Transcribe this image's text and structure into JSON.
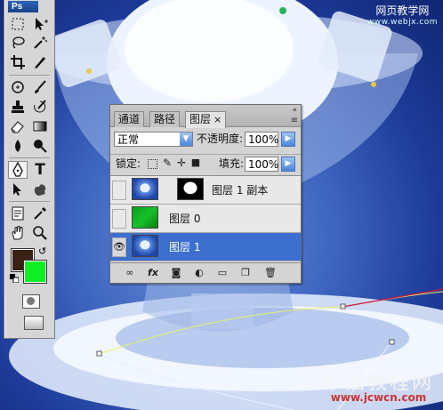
{
  "watermark_top": {
    "line1": "网页教学网",
    "line2": "www.webjx.com"
  },
  "watermark_bottom": {
    "line1": "中国教程网",
    "line2": "www.jcwcn.com"
  },
  "tools_panel": {
    "logo": "Ps",
    "tools": [
      "marquee-tool",
      "move-tool",
      "lasso-tool",
      "magic-wand-tool",
      "crop-tool",
      "slice-tool",
      "healing-brush-tool",
      "brush-tool",
      "clone-stamp-tool",
      "history-brush-tool",
      "eraser-tool",
      "gradient-tool",
      "blur-tool",
      "dodge-tool",
      "pen-tool",
      "type-tool",
      "path-selection-tool",
      "custom-shape-tool",
      "notes-tool",
      "eyedropper-tool",
      "hand-tool",
      "zoom-tool"
    ],
    "type_tool_glyph": "T",
    "colors": {
      "foreground": "#3a2114",
      "background": "#0ef025"
    }
  },
  "layers_panel": {
    "tabs": [
      {
        "label": "通道",
        "active": false
      },
      {
        "label": "路径",
        "active": false
      },
      {
        "label": "图层",
        "active": true,
        "close": "×"
      }
    ],
    "collapse": "«",
    "menu": "≡",
    "blend_mode": "正常",
    "opacity_label": "不透明度:",
    "opacity_value": "100%",
    "lock_label": "锁定:",
    "fill_label": "填充:",
    "fill_value": "100%",
    "layers": [
      {
        "name": "图层 1 副本",
        "visible": false,
        "selected": false,
        "thumb": "blue",
        "has_mask": true
      },
      {
        "name": "图层 0",
        "visible": false,
        "selected": false,
        "thumb": "green",
        "has_mask": false
      },
      {
        "name": "图层 1",
        "visible": true,
        "selected": true,
        "thumb": "blue",
        "has_mask": false
      }
    ],
    "bottom_icons": [
      "link-icon",
      "fx-icon",
      "add-mask-icon",
      "adjustment-layer-icon",
      "new-group-icon",
      "new-layer-icon",
      "delete-layer-icon"
    ],
    "fx_label": "fx"
  }
}
